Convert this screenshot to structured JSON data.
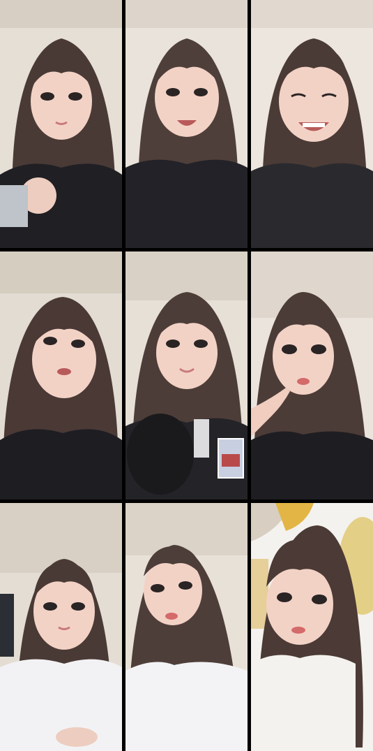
{
  "grid": {
    "columns": 3,
    "rows": 3,
    "tiles": [
      {
        "name": "tile-1",
        "wall": "#e6dfd6",
        "ceiling": "#d8cfc4",
        "hair": "#4a3a36",
        "top": "#1f1f24",
        "expression": "neutral",
        "hand": "fist"
      },
      {
        "name": "tile-2",
        "wall": "#e9e3db",
        "ceiling": "#ddd5cb",
        "hair": "#4f3f3a",
        "top": "#222228",
        "expression": "smile",
        "hand": "none"
      },
      {
        "name": "tile-3",
        "wall": "#ece6de",
        "ceiling": "#e1d9cf",
        "hair": "#4b3b36",
        "top": "#2a2a2e",
        "expression": "laugh",
        "hand": "none"
      },
      {
        "name": "tile-4",
        "wall": "#e2dcd3",
        "ceiling": "#d6cdc1",
        "hair": "#4a3935",
        "top": "#1d1d22",
        "expression": "talk",
        "hand": "none"
      },
      {
        "name": "tile-5",
        "wall": "#e7e0d7",
        "ceiling": "#dad1c6",
        "hair": "#4d3d38",
        "top": "#232328",
        "expression": "smile",
        "hand": "mic"
      },
      {
        "name": "tile-6",
        "wall": "#ebe4dc",
        "ceiling": "#dfd7cd",
        "hair": "#4c3c37",
        "top": "#1e1e22",
        "expression": "pout",
        "hand": "finger"
      },
      {
        "name": "tile-7",
        "wall": "#e4ddd4",
        "ceiling": "#d9d0c5",
        "hair": "#4a3a35",
        "top": "#f2f2f4",
        "expression": "neutral",
        "hand": "low"
      },
      {
        "name": "tile-8",
        "wall": "#e8e1d8",
        "ceiling": "#dcd3c8",
        "hair": "#4e3e39",
        "top": "#f3f3f5",
        "expression": "pout",
        "hand": "none"
      },
      {
        "name": "tile-9",
        "wall": "#e9e5dd",
        "ceiling": "#d8cfc2",
        "hair": "#4b3a35",
        "top": "#f4f2ee",
        "expression": "neutral",
        "hand": "pillow"
      }
    ]
  }
}
